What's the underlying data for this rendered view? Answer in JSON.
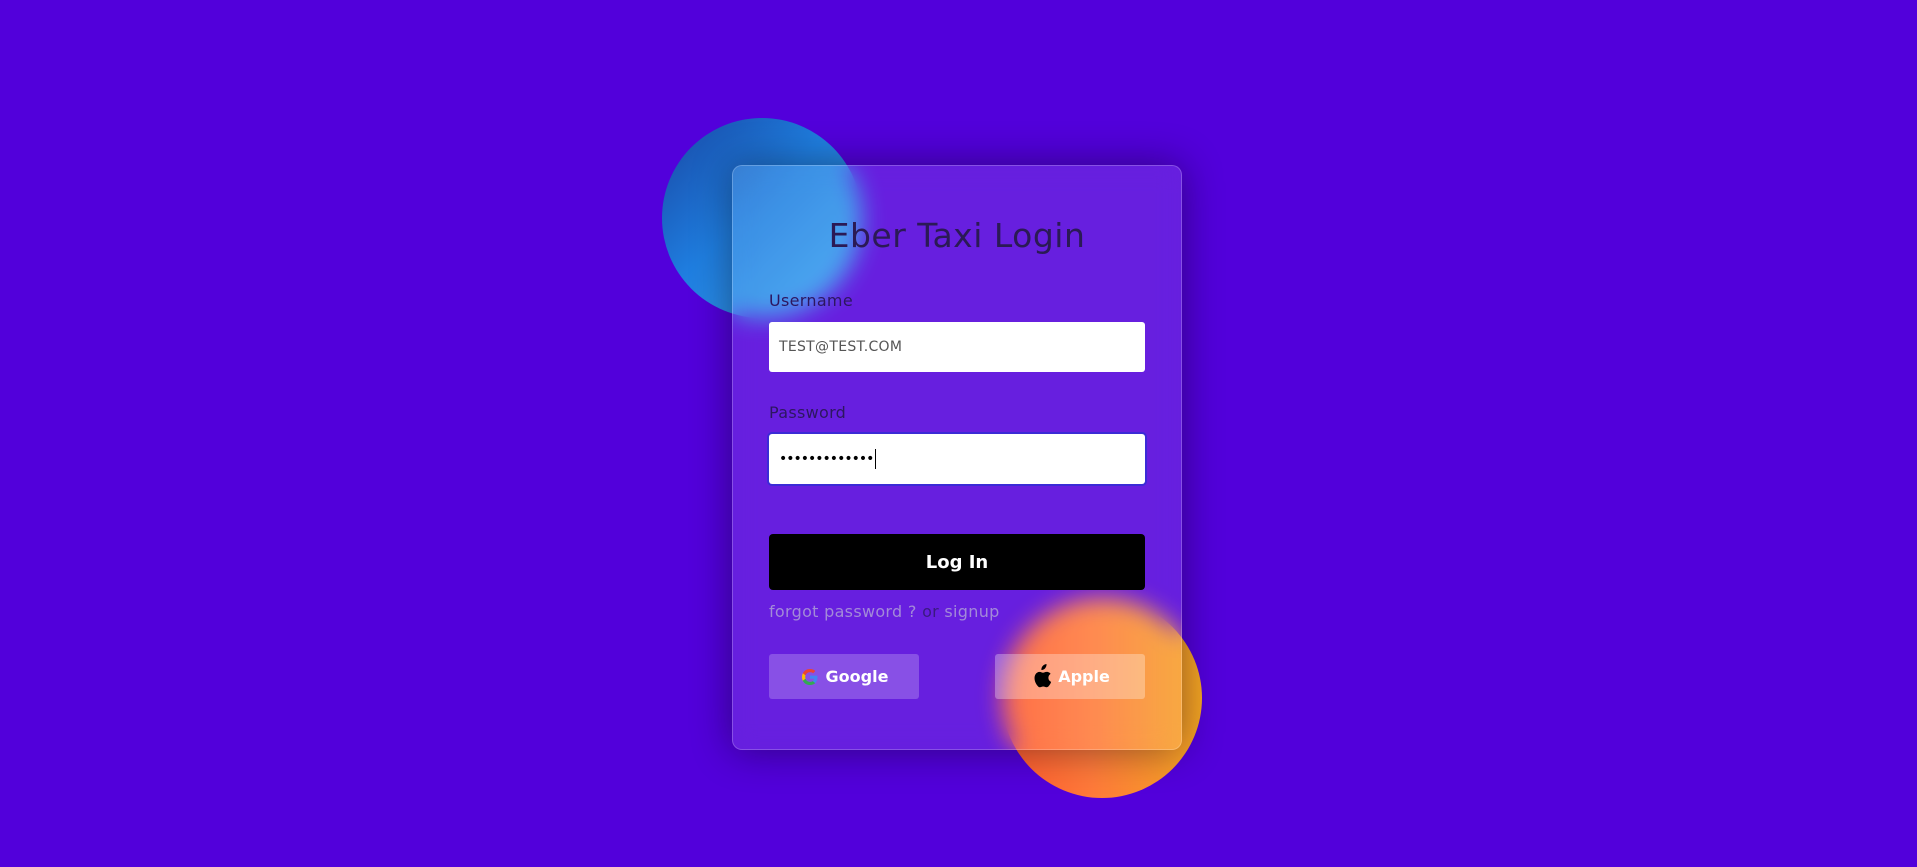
{
  "page": {
    "background_color": "#5200db"
  },
  "login_card": {
    "title": "Eber Taxi Login",
    "username": {
      "label": "Username",
      "value": "TEST@TEST.COM"
    },
    "password": {
      "label": "Password",
      "masked_value": "•••••••••••••"
    },
    "login_button_label": "Log In",
    "forgot_password_link": "forgot password ?",
    "or_text": "or",
    "signup_link": "signup",
    "social": {
      "google_label": "Google",
      "google_icon": "google-icon",
      "apple_label": "Apple",
      "apple_icon": "apple-icon"
    }
  },
  "decorations": {
    "blue_circle_color": "#1f7ee0",
    "orange_circle_color": "#ff7a3a"
  }
}
